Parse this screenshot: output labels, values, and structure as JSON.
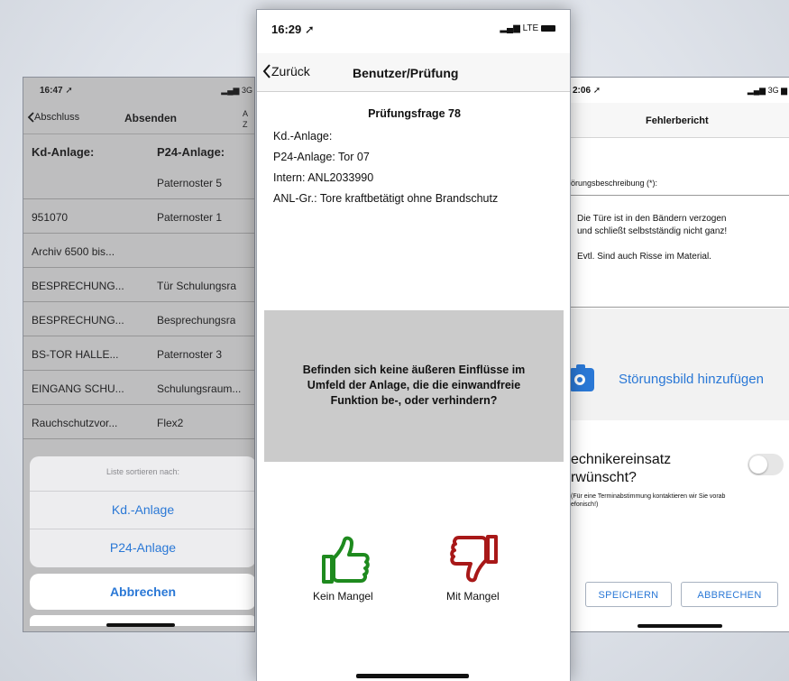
{
  "left_screen": {
    "status_time": "16:47",
    "status_signal": "3G",
    "back_label": "Abschluss",
    "title": "Absenden",
    "sort_az": [
      "A",
      "Z"
    ],
    "headers": [
      "Kd-Anlage:",
      "P24-Anlage:"
    ],
    "rows": [
      [
        "",
        "Paternoster 5"
      ],
      [
        "951070",
        "Paternoster 1"
      ],
      [
        "Archiv 6500 bis...",
        ""
      ],
      [
        "BESPRECHUNG...",
        "Tür Schulungsra"
      ],
      [
        "BESPRECHUNG...",
        "Besprechungsra"
      ],
      [
        "BS-TOR HALLE...",
        "Paternoster 3"
      ],
      [
        "EINGANG SCHU...",
        "Schulungsraum..."
      ],
      [
        "Rauchschutzvor...",
        "Flex2"
      ]
    ],
    "sheet": {
      "title": "Liste sortieren nach:",
      "options": [
        "Kd.-Anlage",
        "P24-Anlage"
      ],
      "cancel": "Abbrechen"
    }
  },
  "center_screen": {
    "status_time": "16:29",
    "status_signal": "LTE",
    "back_label": "Zurück",
    "title": "Benutzer/Prüfung",
    "question_title": "Prüfungsfrage 78",
    "info_lines": [
      "Kd.-Anlage:",
      "P24-Anlage: Tor 07",
      "Intern: ANL2033990",
      "ANL-Gr.: Tore kraftbetätigt ohne Brandschutz"
    ],
    "question_lines": [
      "Befinden sich keine äußeren Einflüsse im",
      "Umfeld der Anlage, die die einwandfreie",
      "Funktion be-, oder verhindern?"
    ],
    "answers": {
      "ok_label": "Kein Mangel",
      "defect_label": "Mit Mangel"
    },
    "colors": {
      "ok": "#1e8a1e",
      "defect": "#a81818"
    }
  },
  "right_screen": {
    "status_time": "2:06",
    "status_signal": "3G",
    "title": "Fehlerbericht",
    "description_label": "örungsbeschreibung (*):",
    "description_lines": [
      "Die Türe ist in den Bändern verzogen",
      "und schließt selbstständig nicht ganz!",
      "",
      "Evtl. Sind auch Risse im Material."
    ],
    "add_image": "Störungsbild hinzufügen",
    "technician_lines": [
      "echnikereinsatz",
      "rwünscht?"
    ],
    "technician_note_lines": [
      "(Für eine Terminabstimmung kontaktieren wir Sie vorab",
      "efonisch!)"
    ],
    "toggle_on": false,
    "save_button": "SPEICHERN",
    "cancel_button": "ABBRECHEN",
    "accent": "#2a78d6"
  }
}
